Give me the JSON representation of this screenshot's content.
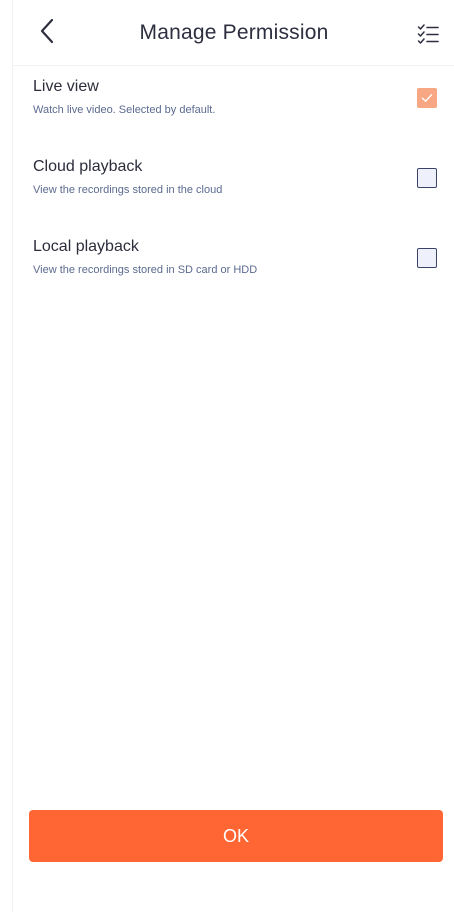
{
  "header": {
    "title": "Manage Permission",
    "back_icon": "chevron-left-icon",
    "select_all_icon": "checklist-icon"
  },
  "permissions": [
    {
      "title": "Live view",
      "description": "Watch live video. Selected by default.",
      "checked": true,
      "disabled": true
    },
    {
      "title": "Cloud playback",
      "description": "View the recordings stored in the cloud",
      "checked": false
    },
    {
      "title": "Local playback",
      "description": "View the recordings stored in SD card or HDD",
      "checked": false
    }
  ],
  "actions": {
    "ok_label": "OK"
  },
  "colors": {
    "accent": "#ff6633",
    "checked_disabled": "#f7a784",
    "text_primary": "#2b2d3b",
    "text_secondary": "#5b6a8f"
  }
}
